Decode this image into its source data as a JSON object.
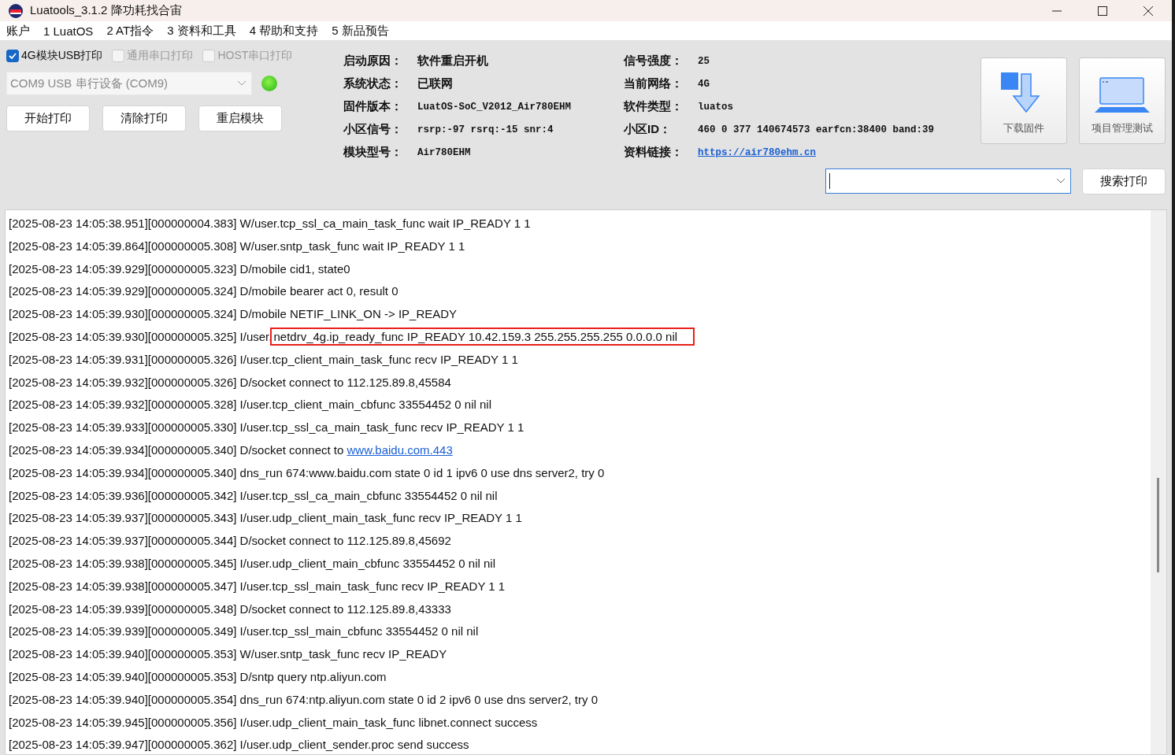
{
  "window": {
    "title": "Luatools_3.1.2 降功耗找合宙"
  },
  "menu": [
    "账户",
    "1 LuatOS",
    "2 AT指令",
    "3 资料和工具",
    "4 帮助和支持",
    "5 新品预告"
  ],
  "print_options": [
    {
      "label": "4G模块USB打印",
      "checked": true,
      "disabled": false
    },
    {
      "label": "通用串口打印",
      "checked": false,
      "disabled": true
    },
    {
      "label": "HOST串口打印",
      "checked": false,
      "disabled": true
    }
  ],
  "port": {
    "value": "COM9 USB 串行设备 (COM9)",
    "disabled": true,
    "connected": true
  },
  "buttons": [
    "开始打印",
    "清除打印",
    "重启模块"
  ],
  "info_left": [
    {
      "label": "启动原因：",
      "value": "软件重启开机",
      "kind": "text"
    },
    {
      "label": "系统状态：",
      "value": "已联网",
      "kind": "text"
    },
    {
      "label": "固件版本：",
      "value": "LuatOS-SoC_V2012_Air780EHM",
      "kind": "text"
    },
    {
      "label": "小区信号：",
      "value": "rsrp:-97 rsrq:-15 snr:4",
      "kind": "text"
    },
    {
      "label": "模块型号：",
      "value": "Air780EHM",
      "kind": "text"
    }
  ],
  "info_right": [
    {
      "label": "信号强度：",
      "value": "25",
      "kind": "text"
    },
    {
      "label": "当前网络：",
      "value": "4G",
      "kind": "text"
    },
    {
      "label": "软件类型：",
      "value": "luatos",
      "kind": "text"
    },
    {
      "label": "小区ID：",
      "value": "460 0 377 140674573 earfcn:38400 band:39",
      "kind": "text"
    },
    {
      "label": "资料链接：",
      "value": "https://air780ehm.cn",
      "kind": "link"
    }
  ],
  "tool_buttons": [
    {
      "label": "下载固件",
      "kind": "download"
    },
    {
      "label": "项目管理测试",
      "kind": "project"
    }
  ],
  "search_button": "搜索打印",
  "log": [
    {
      "text": "[2025-08-23 14:05:38.951][000000004.383] W/user.tcp_ssl_ca_main_task_func wait IP_READY 1 1"
    },
    {
      "text": "[2025-08-23 14:05:39.864][000000005.308] W/user.sntp_task_func wait IP_READY 1 1"
    },
    {
      "text": "[2025-08-23 14:05:39.929][000000005.323] D/mobile cid1, state0"
    },
    {
      "text": "[2025-08-23 14:05:39.929][000000005.324] D/mobile bearer act 0, result 0"
    },
    {
      "text": "[2025-08-23 14:05:39.930][000000005.324] D/mobile NETIF_LINK_ON -> IP_READY"
    },
    {
      "text": "[2025-08-23 14:05:39.930][000000005.325] I/user.",
      "highlighted": "netdrv_4g.ip_ready_func IP_READY 10.42.159.3 255.255.255.255 0.0.0.0 nil"
    },
    {
      "text": "[2025-08-23 14:05:39.931][000000005.326] I/user.tcp_client_main_task_func recv IP_READY 1 1"
    },
    {
      "text": "[2025-08-23 14:05:39.932][000000005.326] D/socket connect to 112.125.89.8,45584"
    },
    {
      "text": "[2025-08-23 14:05:39.932][000000005.328] I/user.tcp_client_main_cbfunc 33554452 0 nil nil"
    },
    {
      "text": "[2025-08-23 14:05:39.933][000000005.330] I/user.tcp_ssl_ca_main_task_func recv IP_READY 1 1"
    },
    {
      "text": "[2025-08-23 14:05:39.934][000000005.340] D/socket connect to ",
      "link": "www.baidu.com.443"
    },
    {
      "text": "[2025-08-23 14:05:39.934][000000005.340] dns_run 674:www.baidu.com state 0 id 1 ipv6 0 use dns server2, try 0"
    },
    {
      "text": "[2025-08-23 14:05:39.936][000000005.342] I/user.tcp_ssl_ca_main_cbfunc 33554452 0 nil nil"
    },
    {
      "text": "[2025-08-23 14:05:39.937][000000005.343] I/user.udp_client_main_task_func recv IP_READY 1 1"
    },
    {
      "text": "[2025-08-23 14:05:39.937][000000005.344] D/socket connect to 112.125.89.8,45692"
    },
    {
      "text": "[2025-08-23 14:05:39.938][000000005.345] I/user.udp_client_main_cbfunc 33554452 0 nil nil"
    },
    {
      "text": "[2025-08-23 14:05:39.938][000000005.347] I/user.tcp_ssl_main_task_func recv IP_READY 1 1"
    },
    {
      "text": "[2025-08-23 14:05:39.939][000000005.348] D/socket connect to 112.125.89.8,43333"
    },
    {
      "text": "[2025-08-23 14:05:39.939][000000005.349] I/user.tcp_ssl_main_cbfunc 33554452 0 nil nil"
    },
    {
      "text": "[2025-08-23 14:05:39.940][000000005.353] W/user.sntp_task_func recv IP_READY"
    },
    {
      "text": "[2025-08-23 14:05:39.940][000000005.353] D/sntp query ntp.aliyun.com"
    },
    {
      "text": "[2025-08-23 14:05:39.940][000000005.354] dns_run 674:ntp.aliyun.com state 0 id 2 ipv6 0 use dns server2, try 0"
    },
    {
      "text": "[2025-08-23 14:05:39.945][000000005.356] I/user.udp_client_main_task_func libnet.connect success"
    },
    {
      "text": "[2025-08-23 14:05:39.947][000000005.362] I/user.udp_client_sender.proc send success"
    }
  ]
}
